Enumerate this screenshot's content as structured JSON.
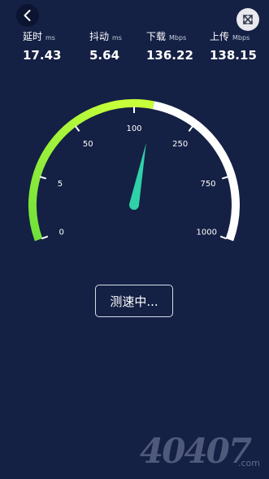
{
  "nav": {
    "back_icon": "chevron-left-icon",
    "fullscreen_icon": "expand-arrows-icon"
  },
  "stats": [
    {
      "label": "延时",
      "unit": "ms",
      "value": "17.43"
    },
    {
      "label": "抖动",
      "unit": "ms",
      "value": "5.64"
    },
    {
      "label": "下载",
      "unit": "Mbps",
      "value": "136.22"
    },
    {
      "label": "上传",
      "unit": "Mbps",
      "value": "138.15"
    }
  ],
  "gauge": {
    "scale_labels": [
      "0",
      "5",
      "50",
      "100",
      "250",
      "750",
      "1000"
    ],
    "fill_fraction": 0.55,
    "colors": {
      "arc_start": "#6ee03a",
      "arc_end": "#c7ff3a",
      "arc_rest": "#ffffff",
      "needle": "#2fd1a8"
    }
  },
  "status_button": "测速中...",
  "watermark": {
    "text": "40407",
    "suffix": ".com"
  }
}
